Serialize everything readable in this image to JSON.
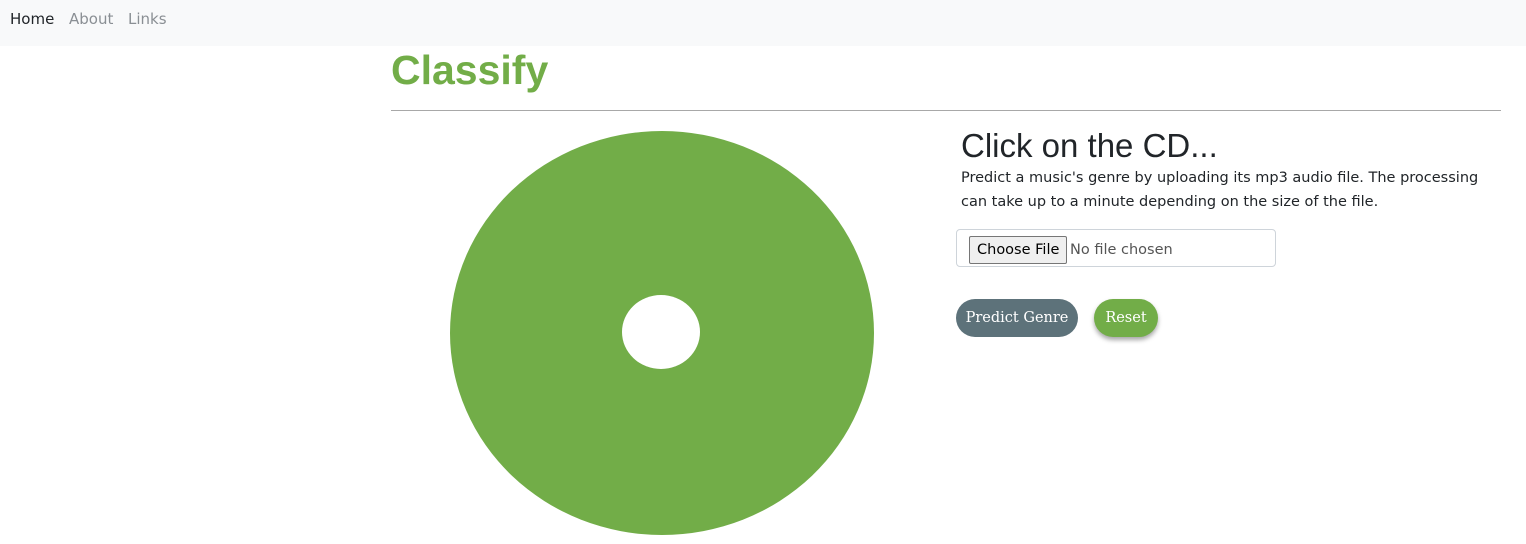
{
  "nav": {
    "items": [
      {
        "label": "Home",
        "active": true
      },
      {
        "label": "About",
        "active": false
      },
      {
        "label": "Links",
        "active": false
      }
    ]
  },
  "page": {
    "title": "Classify"
  },
  "upload": {
    "heading": "Click on the CD...",
    "description": "Predict a music's genre by uploading its mp3 audio file. The processing can take up to a minute depending on the size of the file.",
    "choose_file_label": "Choose File",
    "file_status": "No file chosen"
  },
  "actions": {
    "predict_label": "Predict Genre",
    "reset_label": "Reset"
  },
  "colors": {
    "brand_green": "#72ad48",
    "predict_button": "#5d727a",
    "navbar_bg": "#f8f9fa"
  },
  "icons": {
    "cd": "cd-disc-icon"
  }
}
